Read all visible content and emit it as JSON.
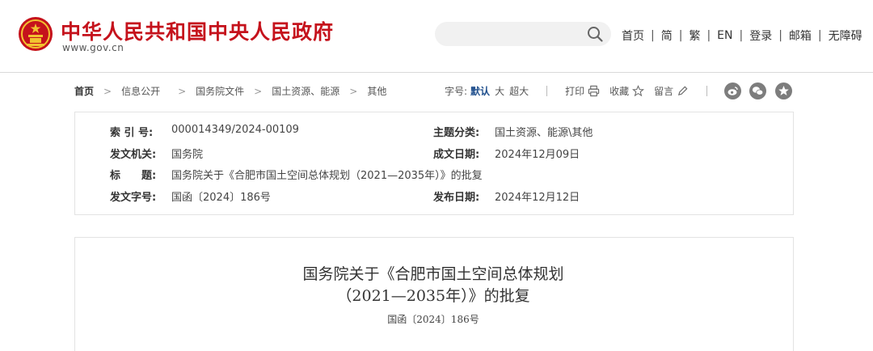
{
  "header": {
    "site_title": "中华人民共和国中央人民政府",
    "site_domain": "www.gov.cn",
    "search": {
      "placeholder": "",
      "value": ""
    },
    "nav": [
      {
        "label": "首页"
      },
      {
        "label": "简"
      },
      {
        "label": "繁"
      },
      {
        "label": "EN"
      },
      {
        "label": "登录"
      },
      {
        "label": "邮箱"
      },
      {
        "label": "无障碍"
      }
    ]
  },
  "breadcrumb": [
    {
      "label": "首页"
    },
    {
      "label": "信息公开"
    },
    {
      "label": "国务院文件"
    },
    {
      "label": "国土资源、能源"
    },
    {
      "label": "其他"
    }
  ],
  "toolbar": {
    "font_size_label": "字号:",
    "font_default": "默认",
    "font_large": "大",
    "font_xlarge": "超大",
    "print": "打印",
    "favorite": "收藏",
    "comment": "留言",
    "share_icons": [
      "weibo-icon",
      "wechat-icon",
      "more-share-icon"
    ]
  },
  "info": {
    "index_no_label": "索 引 号:",
    "index_no": "000014349/2024-00109",
    "category_label": "主题分类:",
    "category": "国土资源、能源\\其他",
    "issuer_label": "发文机关:",
    "issuer": "国务院",
    "created_label": "成文日期:",
    "created": "2024年12月09日",
    "title_label": "标　　题:",
    "title": "国务院关于《合肥市国土空间总体规划（2021—2035年）》的批复",
    "doc_no_label": "发文字号:",
    "doc_no": "国函〔2024〕186号",
    "published_label": "发布日期:",
    "published": "2024年12月12日"
  },
  "article": {
    "title_line1": "国务院关于《合肥市国土空间总体规划",
    "title_line2": "（2021—2035年）》的批复",
    "doc_no": "国函〔2024〕186号"
  },
  "colors": {
    "brand_red": "#c5121c",
    "active_blue": "#1e4e8c",
    "share_gray": "#7d7d7d"
  }
}
